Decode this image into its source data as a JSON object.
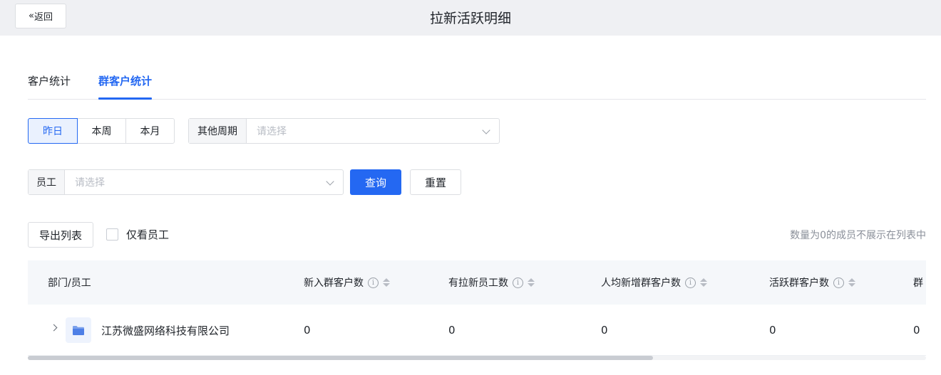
{
  "header": {
    "back_label": "返回",
    "title": "拉新活跃明细"
  },
  "tabs": [
    {
      "label": "客户统计",
      "active": false
    },
    {
      "label": "群客户统计",
      "active": true
    }
  ],
  "filters": {
    "range_buttons": [
      "昨日",
      "本周",
      "本月"
    ],
    "range_selected": "昨日",
    "period_label": "其他周期",
    "period_placeholder": "请选择",
    "staff_label": "员工",
    "staff_placeholder": "请选择",
    "query_label": "查询",
    "reset_label": "重置"
  },
  "toolbar": {
    "export_label": "导出列表",
    "only_staff_label": "仅看员工",
    "only_staff_checked": false,
    "hint": "数量为0的成员不展示在列表中"
  },
  "table": {
    "columns": [
      "部门/员工",
      "新入群客户数",
      "有拉新员工数",
      "人均新增群客户数",
      "活跃群客户数",
      "群"
    ],
    "rows": [
      {
        "name": "江苏微盛网络科技有限公司",
        "values": [
          "0",
          "0",
          "0",
          "0",
          "0"
        ]
      }
    ]
  },
  "colors": {
    "accent": "#2468f2",
    "header_bg": "#eff0f3",
    "table_header_bg": "#f5f7fa"
  },
  "icons": {
    "back": "double-chevron-left-icon",
    "select_caret": "chevron-down-icon",
    "info": "info-circle-icon",
    "sort": "sort-icon",
    "expand": "chevron-right-icon",
    "folder": "folder-icon"
  }
}
